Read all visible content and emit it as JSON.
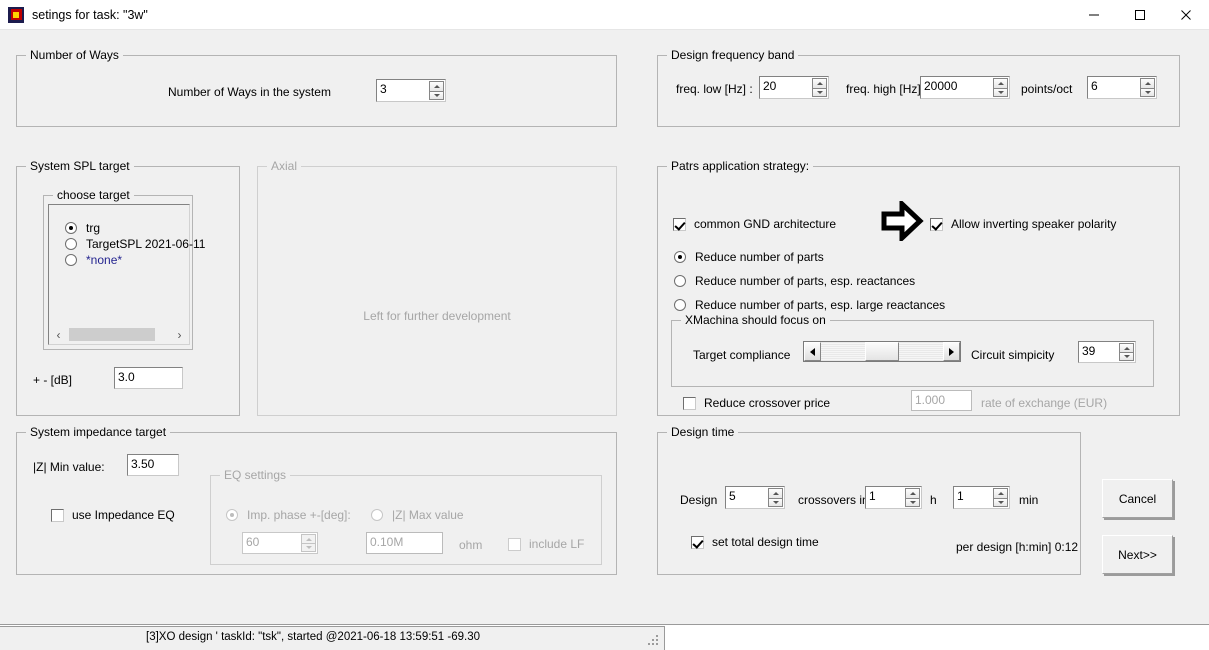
{
  "window": {
    "title": "setings for task: \"3w\"",
    "icon": "app-icon",
    "minimize_label": "–",
    "maximize_label": "□",
    "close_label": "✕"
  },
  "number_of_ways": {
    "group_title": "Number of Ways",
    "label": "Number of Ways in the system",
    "value": "3"
  },
  "design_frequency_band": {
    "group_title": "Design frequency band",
    "freq_low_label": "freq. low [Hz] :",
    "freq_low_value": "20",
    "freq_high_label": "freq. high [Hz] :",
    "freq_high_value": "20000",
    "points_oct_label": "points/oct",
    "points_oct_value": "6"
  },
  "system_spl_target": {
    "group_title": "System SPL target",
    "choose_target_title": "choose target",
    "options": [
      {
        "label": "trg",
        "selected": true,
        "blue": false
      },
      {
        "label": "TargetSPL 2021-06-11",
        "selected": false,
        "blue": false
      },
      {
        "label": "*none*",
        "selected": false,
        "blue": true
      }
    ],
    "scroll_left_icon": "chevron-left-icon",
    "scroll_right_icon": "chevron-right-icon",
    "db_label": "+ - [dB]",
    "db_value": "3.0"
  },
  "axial": {
    "group_title": "Axial",
    "placeholder_text": "Left for further development"
  },
  "parts_strategy": {
    "group_title": "Patrs application strategy:",
    "common_gnd_label": "common GND architecture",
    "common_gnd_checked": true,
    "allow_invert_label": "Allow inverting speaker polarity",
    "allow_invert_checked": true,
    "annotation_icon": "right-arrow-annotation-icon",
    "radios": [
      {
        "label": "Reduce number of parts",
        "selected": true
      },
      {
        "label": "Reduce number of parts, esp. reactances",
        "selected": false
      },
      {
        "label": "Reduce number of parts, esp. large reactances",
        "selected": false
      }
    ],
    "xmachina": {
      "group_title": "XMachina should focus on",
      "left_label": "Target compliance",
      "right_label": "Circuit simpicity",
      "slider_value": 39,
      "slider_min": 0,
      "slider_max": 100,
      "spin_value": "39",
      "left_arrow_icon": "slider-left-arrow-icon",
      "right_arrow_icon": "slider-right-arrow-icon"
    },
    "reduce_price_label": "Reduce crossover price",
    "reduce_price_checked": false,
    "rate_value": "1.000",
    "rate_label": "rate of exchange (EUR)"
  },
  "system_impedance_target": {
    "group_title": "System impedance target",
    "zmin_label": "|Z| Min value:",
    "zmin_value": "3.50",
    "use_eq_label": "use Impedance EQ",
    "use_eq_checked": false,
    "eq_settings": {
      "group_title": "EQ settings",
      "imp_phase_label": "Imp. phase +-[deg]:",
      "imp_phase_selected": true,
      "imp_phase_value": "60",
      "zmax_label": "|Z| Max value",
      "zmax_selected": false,
      "zmax_value": "0.10M",
      "ohm_label": "ohm",
      "include_lf_label": "include LF",
      "include_lf_checked": false
    }
  },
  "design_time": {
    "group_title": "Design time",
    "design_label": "Design",
    "count_value": "5",
    "crossovers_label": "crossovers in",
    "hours_value": "1",
    "hours_unit": "h",
    "minutes_value": "1",
    "minutes_unit": "min",
    "set_total_label": "set total design time",
    "set_total_checked": true,
    "per_design_label": "per design [h:min] 0:12"
  },
  "buttons": {
    "cancel": "Cancel",
    "next": "Next>>"
  },
  "statusbar": {
    "text": "[3]XO design ' taskId: \"tsk\", started @2021-06-18 13:59:51 -69.30",
    "grip_icon": "resize-grip-icon"
  }
}
